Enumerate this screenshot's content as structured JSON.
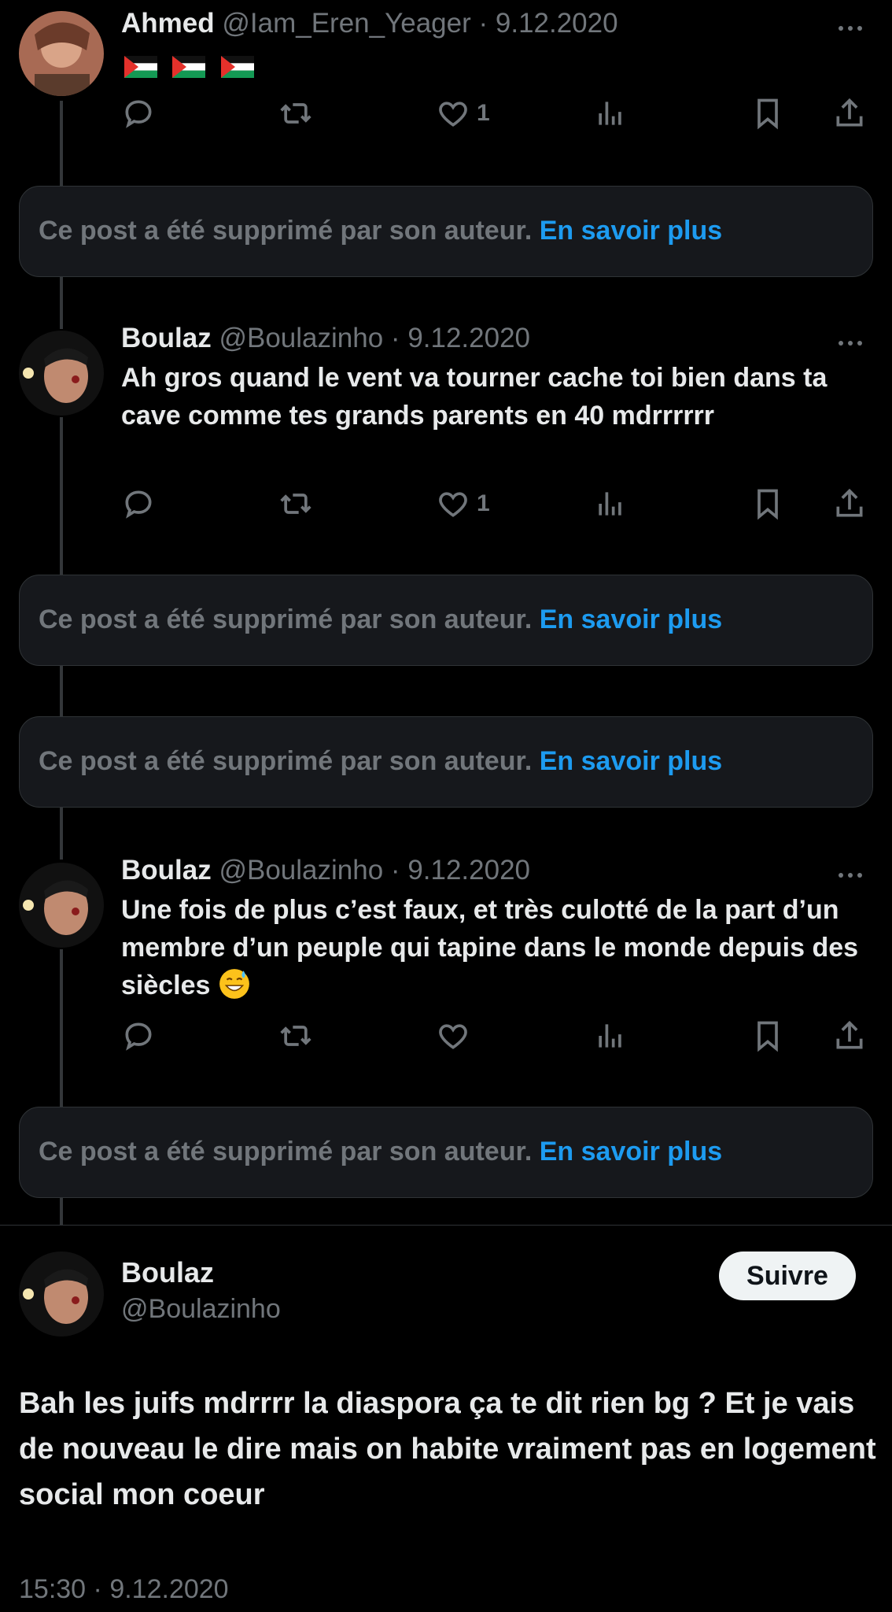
{
  "tweets": [
    {
      "name": "Ahmed",
      "handle": "@Iam_Eren_Yeager",
      "date": "9.12.2020",
      "text": "",
      "flags": 3,
      "likes": "1"
    },
    {
      "name": "Boulaz",
      "handle": "@Boulazinho",
      "date": "9.12.2020",
      "text": "Ah gros quand le vent va tourner cache toi bien dans ta cave comme tes grands parents en 40 mdrrrrrr",
      "likes": "1"
    },
    {
      "name": "Boulaz",
      "handle": "@Boulazinho",
      "date": "9.12.2020",
      "text": "Une fois de plus c’est faux, et très culotté de la part d’un membre d’un peuple qui tapine dans le monde depuis des siècles",
      "emoji": "grinning-sweat",
      "likes": ""
    }
  ],
  "deleted": {
    "text": "Ce post a été supprimé par son auteur.",
    "link": "En savoir plus"
  },
  "main": {
    "name": "Boulaz",
    "handle": "@Boulazinho",
    "follow_label": "Suivre",
    "text": "Bah les juifs mdrrrr la diaspora ça te dit rien bg ? Et je vais de nouveau le dire mais on habite vraiment pas en logement social mon coeur",
    "time": "15:30",
    "date": "9.12.2020"
  },
  "colors": {
    "accent": "#1d9bf0",
    "muted": "#71767b",
    "card": "#16181c",
    "bg": "#000000"
  },
  "icons": [
    "reply-icon",
    "retweet-icon",
    "like-icon",
    "views-icon",
    "bookmark-icon",
    "share-icon",
    "more-icon",
    "palestine-flag-icon"
  ]
}
